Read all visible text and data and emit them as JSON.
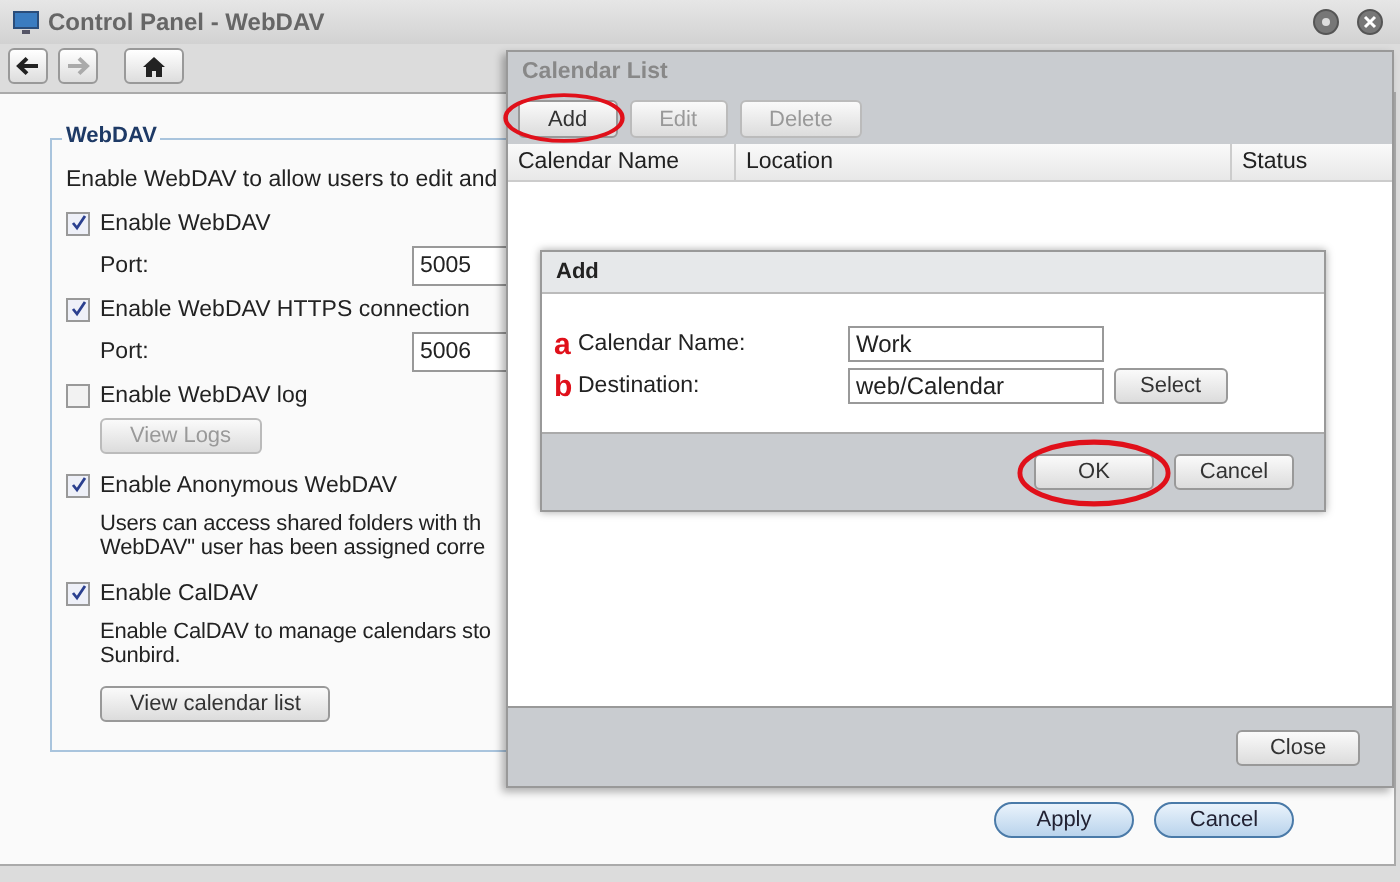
{
  "window": {
    "title": "Control Panel - WebDAV"
  },
  "nav_buttons": [
    {
      "kind": "back",
      "disabled": false
    },
    {
      "kind": "forward",
      "disabled": true
    },
    {
      "kind": "home",
      "disabled": false
    }
  ],
  "webdav": {
    "legend": "WebDAV",
    "description": "Enable WebDAV to allow users to edit and",
    "items": [
      {
        "kind": "checkbox",
        "label": "Enable WebDAV",
        "checked": true
      },
      {
        "kind": "port",
        "label": "Port:",
        "value": "5005"
      },
      {
        "kind": "checkbox",
        "label": "Enable WebDAV HTTPS connection",
        "checked": true
      },
      {
        "kind": "port",
        "label": "Port:",
        "value": "5006"
      },
      {
        "kind": "checkbox",
        "label": "Enable WebDAV log",
        "checked": false
      },
      {
        "kind": "button",
        "label": "View Logs",
        "disabled": true
      },
      {
        "kind": "checkbox",
        "label": "Enable Anonymous WebDAV",
        "checked": true
      },
      {
        "kind": "note",
        "lines": [
          "Users can access shared folders with th",
          "WebDAV\" user has been assigned corre"
        ]
      },
      {
        "kind": "checkbox",
        "label": "Enable CalDAV",
        "checked": true
      },
      {
        "kind": "note",
        "lines": [
          "Enable CalDAV to manage calendars sto",
          "Sunbird."
        ]
      },
      {
        "kind": "button",
        "label": "View calendar list",
        "disabled": false
      }
    ]
  },
  "buttons": [
    "Apply",
    "Cancel"
  ],
  "calendar_list": {
    "title": "Calendar List",
    "toolbar": [
      {
        "label": "Add",
        "disabled": false,
        "highlighted": true
      },
      {
        "label": "Edit",
        "disabled": true,
        "highlighted": false
      },
      {
        "label": "Delete",
        "disabled": true,
        "highlighted": false
      }
    ],
    "columns": [
      "Calendar Name",
      "Location",
      "Status"
    ],
    "close": "Close"
  },
  "add_dialog": {
    "title": "Add",
    "fields": [
      {
        "marker": "a",
        "label": "Calendar Name:",
        "value": "Work"
      },
      {
        "marker": "b",
        "label": "Destination:",
        "value": "web/Calendar",
        "button": "Select"
      }
    ],
    "buttons": [
      {
        "label": "OK",
        "highlighted": true
      },
      {
        "label": "Cancel",
        "highlighted": false
      }
    ]
  }
}
